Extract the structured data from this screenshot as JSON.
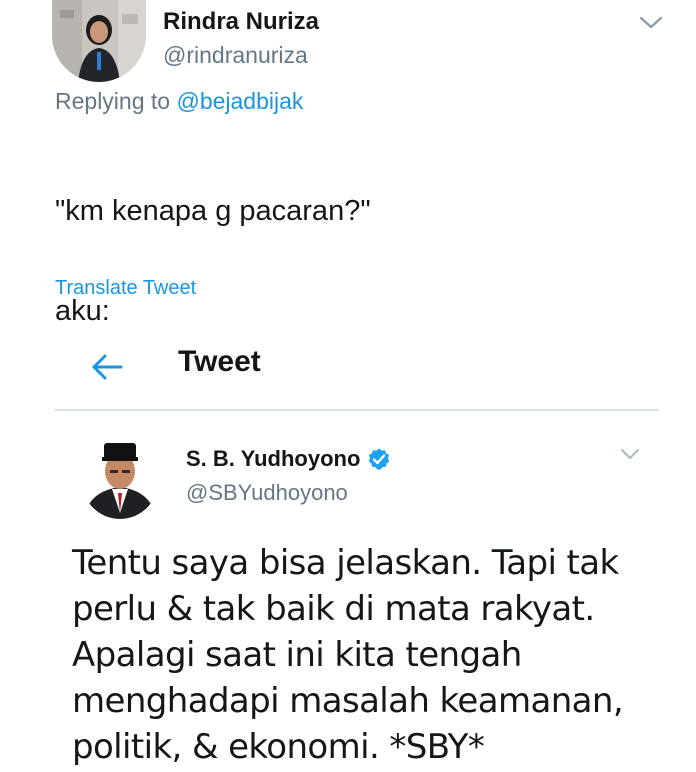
{
  "outer_tweet": {
    "display_name": "Rindra Nuriza",
    "handle": "@rindranuriza",
    "replying_prefix": "Replying to",
    "replying_to": "@bejadbijak",
    "text_lines": [
      "\"km kenapa g pacaran?\"",
      "aku:"
    ],
    "translate_label": "Translate Tweet"
  },
  "embedded_screen": {
    "nav_title": "Tweet",
    "tweet": {
      "display_name": "S. B. Yudhoyono",
      "handle": "@SBYudhoyono",
      "text_lines": [
        "Tentu saya bisa jelaskan. Tapi tak",
        "perlu & tak baik di mata rakyat.",
        "Apalagi saat ini kita tengah",
        "menghadapi masalah keamanan,",
        "politik, & ekonomi. *SBY*"
      ]
    }
  },
  "colors": {
    "link_blue": "#1b95e0",
    "muted_gray": "#657786",
    "text_dark": "#14171a",
    "divider": "#d9dfe3"
  },
  "icons": [
    "chevron-down-icon",
    "back-arrow-icon",
    "verified-badge-icon"
  ]
}
